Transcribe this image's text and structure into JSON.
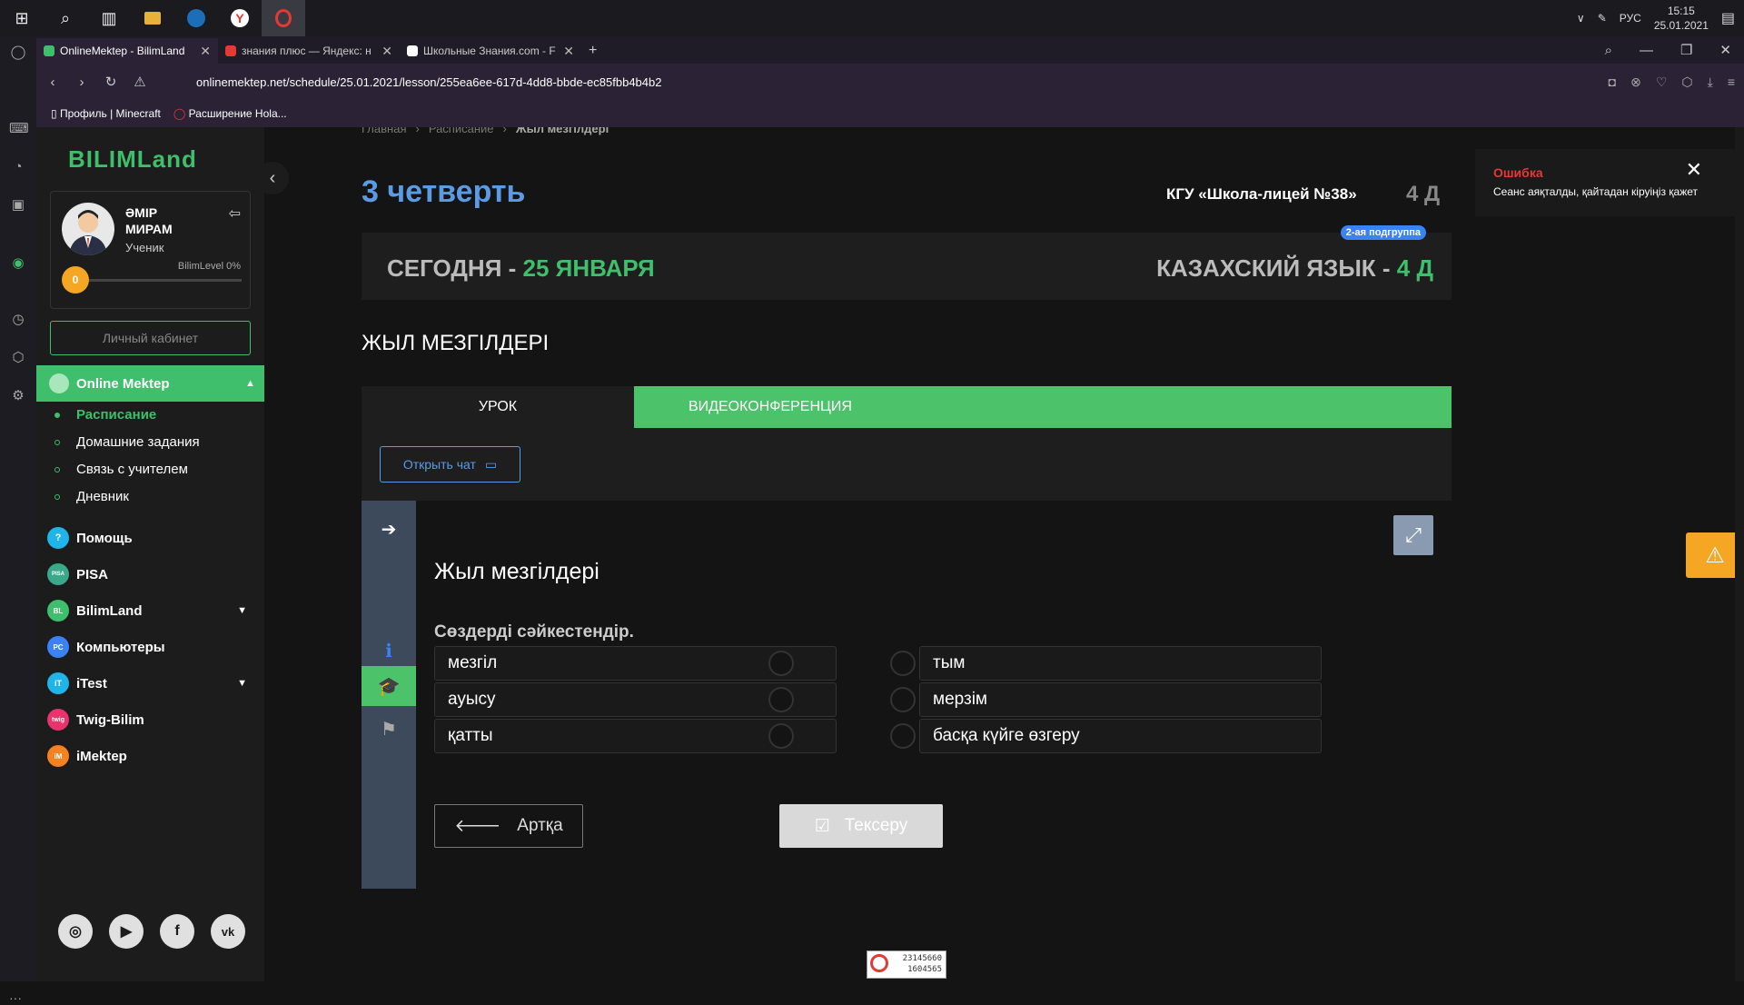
{
  "taskbar": {
    "tray_lang": "РУС",
    "time": "15:15",
    "date": "25.01.2021"
  },
  "tabs": [
    {
      "label": "OnlineMektep - BilimLand",
      "active": true
    },
    {
      "label": "знания плюс — Яндекс: н",
      "active": false
    },
    {
      "label": "Школьные Знания.com - F",
      "active": false
    }
  ],
  "address": {
    "url": "onlinemektep.net/schedule/25.01.2021/lesson/255ea6ee-617d-4dd8-bbde-ec85fbb4b4b2"
  },
  "bookmarks": [
    "Профиль | Minecraft",
    "Расширение Hola..."
  ],
  "sidebar": {
    "logo": "BILIMLand",
    "user_name": "ӘМІР МИРАМ",
    "user_role": "Ученик",
    "level_label": "BilimLevel 0%",
    "level_value": "0",
    "cabinet_label": "Личный кабинет",
    "section_title": "Online Mektep",
    "submenu": [
      "Расписание",
      "Домашние задания",
      "Связь с учителем",
      "Дневник"
    ],
    "menu": [
      {
        "label": "Помощь",
        "icon": "?",
        "color": "#1fb5e8"
      },
      {
        "label": "PISA",
        "icon": "PISA",
        "color": "#3aa88a"
      },
      {
        "label": "BilimLand",
        "icon": "BL",
        "color": "#3fbf6b"
      },
      {
        "label": "Компьютеры",
        "icon": "PC",
        "color": "#3b82f6"
      },
      {
        "label": "iTest",
        "icon": "iT",
        "color": "#1fb5e8"
      },
      {
        "label": "Twig-Bilim",
        "icon": "twig",
        "color": "#e8336d"
      },
      {
        "label": "iMektep",
        "icon": "iM",
        "color": "#f58220"
      }
    ]
  },
  "breadcrumb": {
    "home": "Главная",
    "schedule": "Расписание",
    "current": "Жыл мезгілдері"
  },
  "header": {
    "quarter": "3 четверть",
    "school": "КГУ «Школа-лицей №38»",
    "grade": "4 Д"
  },
  "banner": {
    "today_label": "СЕГОДНЯ - ",
    "today_date": "25 ЯНВАРЯ",
    "subject_label": "КАЗАХСКИЙ ЯЗЫК - ",
    "subject_grade": "4 Д",
    "subgroup": "2-ая подгруппа"
  },
  "lesson": {
    "title": "ЖЫЛ МЕЗГІЛДЕРІ",
    "tab_lesson": "УРОК",
    "tab_video": "ВИДЕОКОНФЕРЕНЦИЯ",
    "open_chat": "Открыть чат"
  },
  "activity": {
    "title": "Жыл мезгілдері",
    "instruction": "Сөздерді сәйкестендір.",
    "left_words": [
      "мезгіл",
      "ауысу",
      "қатты"
    ],
    "right_words": [
      "тым",
      "мерзім",
      "басқа күйге өзгеру"
    ],
    "back_label": "Артқа",
    "check_label": "Тексеру"
  },
  "toast": {
    "title": "Ошибка",
    "message": "Сеанс аяқталды, қайтадан кіруіңіз қажет"
  },
  "counter": {
    "line1": "23145660",
    "line2": "1604565"
  }
}
